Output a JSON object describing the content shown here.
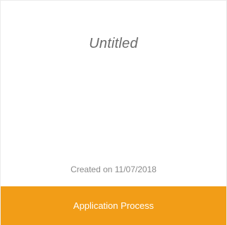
{
  "card": {
    "title": "Untitled",
    "created": "Created on 11/07/2018",
    "category": "Application Process"
  },
  "colors": {
    "accent": "#f29d17",
    "title_text": "#6b6b6b",
    "meta_text": "#8a8a8a"
  }
}
